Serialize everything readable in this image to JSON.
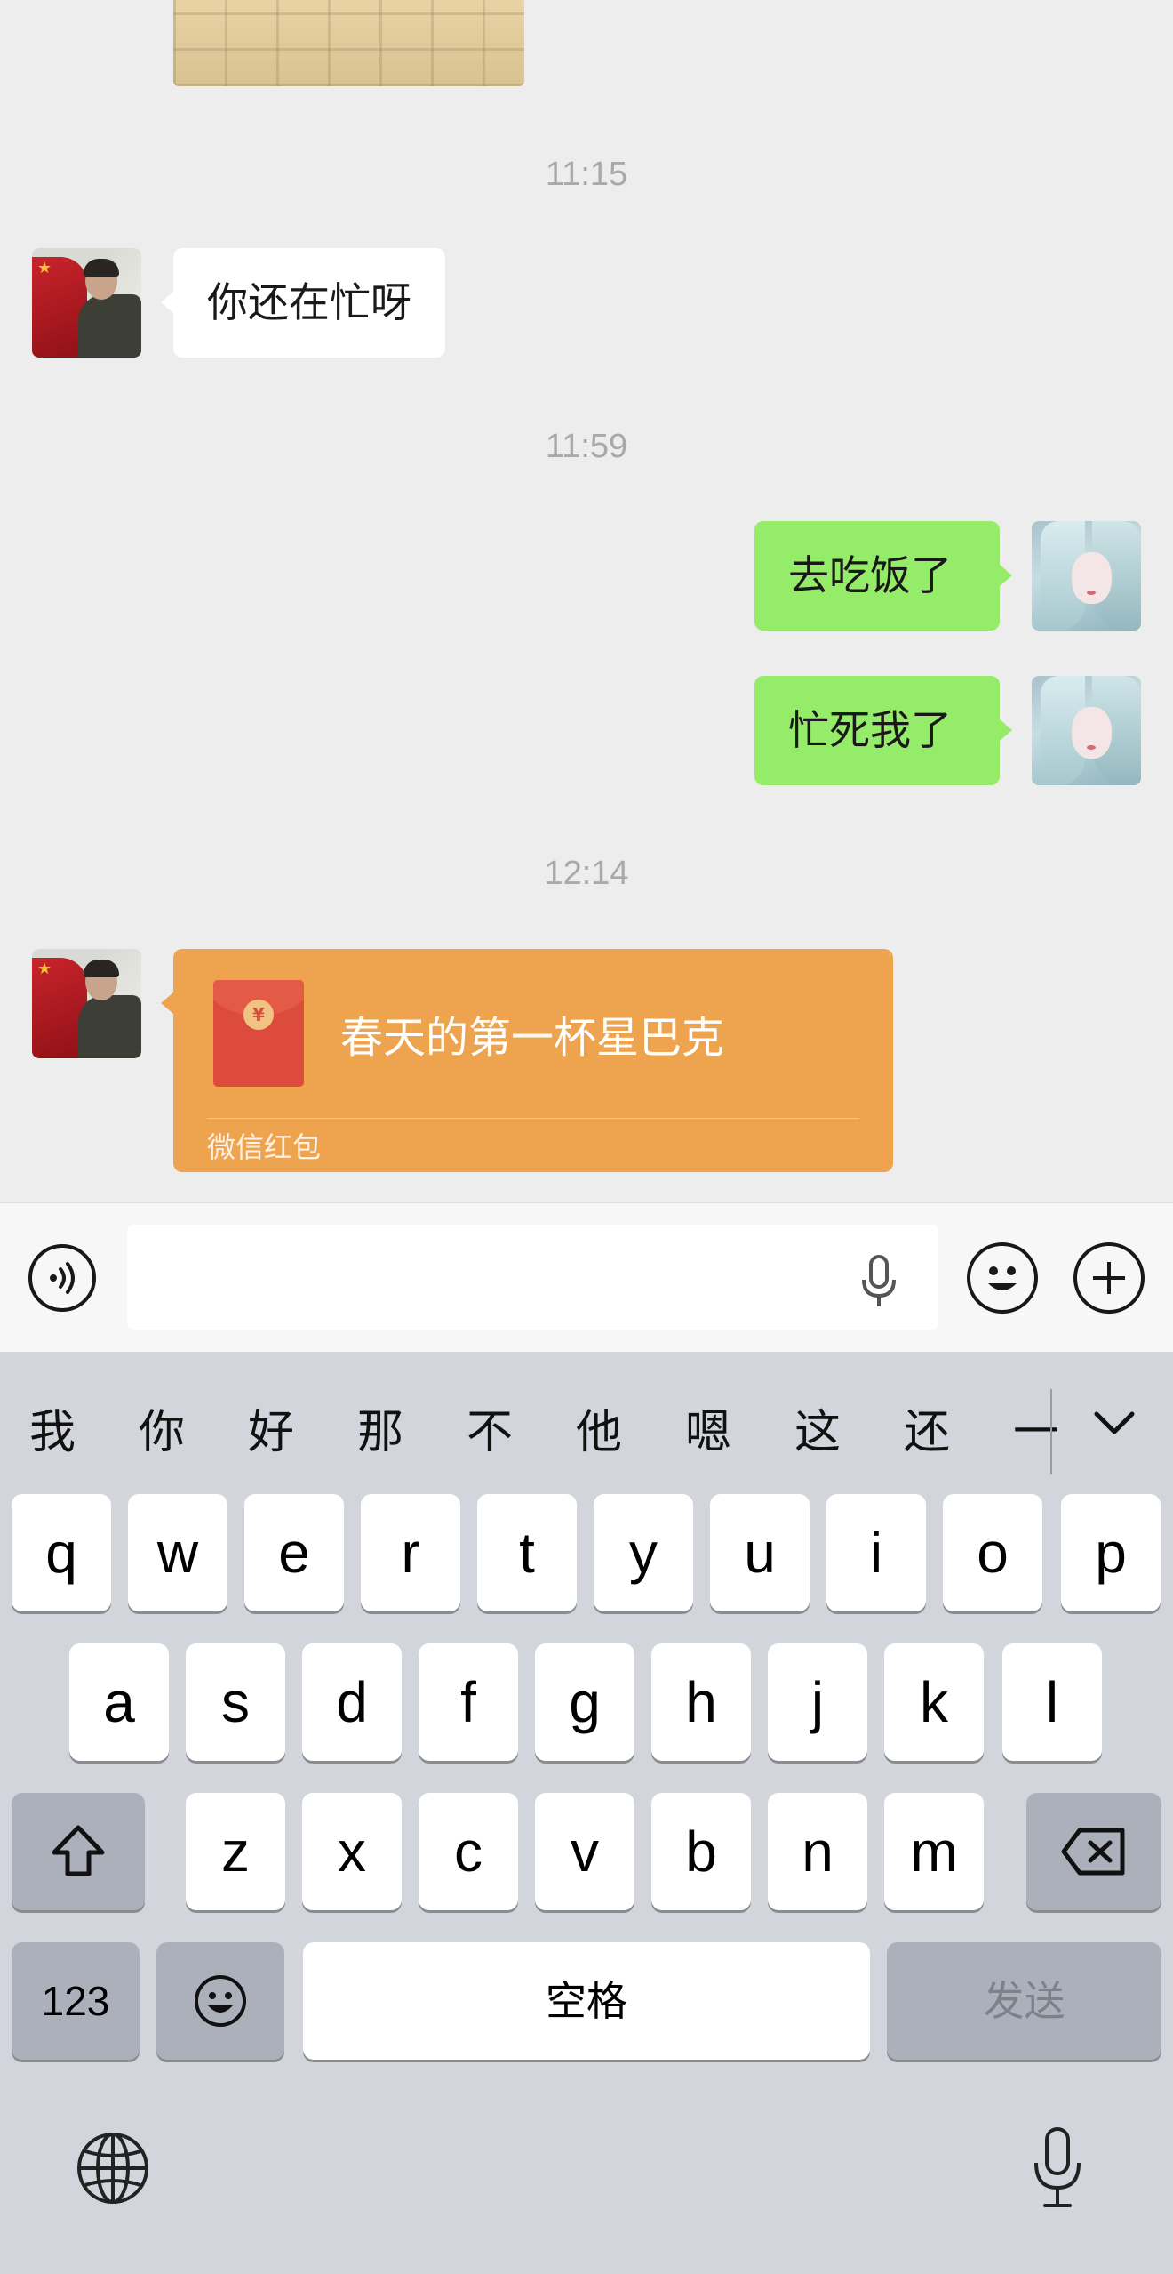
{
  "chat": {
    "messages": [
      {
        "type": "time",
        "text": "11:15"
      },
      {
        "type": "text",
        "from": "friend",
        "text": "你还在忙呀"
      },
      {
        "type": "time",
        "text": "11:59"
      },
      {
        "type": "text",
        "from": "me",
        "text": "去吃饭了"
      },
      {
        "type": "text",
        "from": "me",
        "text": "忙死我了"
      },
      {
        "type": "time",
        "text": "12:14"
      },
      {
        "type": "red_packet",
        "from": "friend",
        "title": "春天的第一杯星巴克",
        "label": "微信红包",
        "icon": "yuan-icon"
      }
    ]
  },
  "input_bar": {
    "voice_icon": "voice-toggle-icon",
    "mic_icon": "microphone-icon",
    "emoji_icon": "emoji-icon",
    "plus_icon": "plus-icon",
    "value": ""
  },
  "keyboard": {
    "candidates": [
      "我",
      "你",
      "好",
      "那",
      "不",
      "他",
      "嗯",
      "这",
      "还",
      "一"
    ],
    "row1": [
      "q",
      "w",
      "e",
      "r",
      "t",
      "y",
      "u",
      "i",
      "o",
      "p"
    ],
    "row2": [
      "a",
      "s",
      "d",
      "f",
      "g",
      "h",
      "j",
      "k",
      "l"
    ],
    "row3": [
      "z",
      "x",
      "c",
      "v",
      "b",
      "n",
      "m"
    ],
    "numbers_label": "123",
    "space_label": "空格",
    "send_label": "发送",
    "accent_colors": {
      "bubble_out": "#95ec69",
      "red_packet": "#eea44f",
      "send_key": "#abb0bb"
    }
  }
}
